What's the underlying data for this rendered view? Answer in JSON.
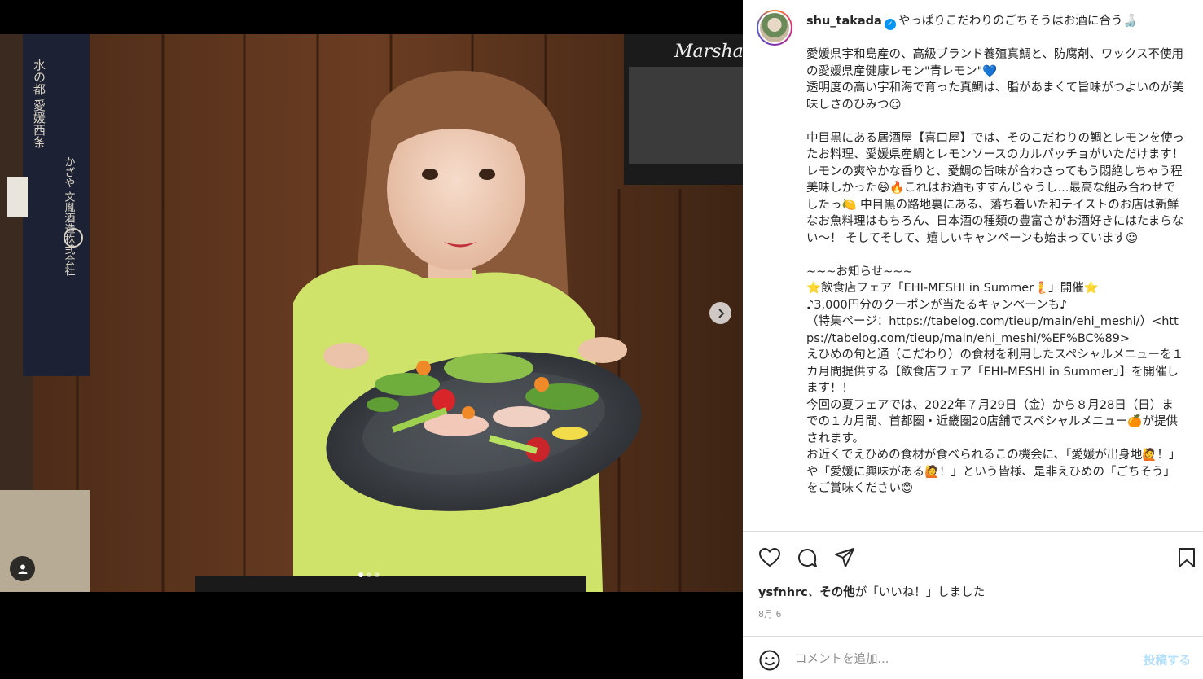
{
  "post": {
    "username": "shu_takada",
    "headline": "やっぱりこだわりのごちそうはお酒に合う🍶",
    "caption": "愛媛県宇和島産の、高級ブランド養殖真鯛と、防腐剤、ワックス不使用の愛媛県産健康レモン\"青レモン\"💙\n透明度の高い宇和海で育った真鯛は、脂があまくて旨味がつよいのが美味しさのひみつ☺\n\n中目黒にある居酒屋【喜口屋】では、そのこだわりの鯛とレモンを使ったお料理、愛媛県産鯛とレモンソースのカルパッチョがいただけます！\nレモンの爽やかな香りと、愛鯛の旨味が合わさってもう悶絶しちゃう程美味しかった😆🔥これはお酒もすすんじゃうし...最高な組み合わせでしたっ🍋 中目黒の路地裏にある、落ち着いた和テイストのお店は新鮮なお魚料理はもちろん、日本酒の種類の豊富さがお酒好きにはたまらない〜！ そしてそして、嬉しいキャンペーンも始まっています☺\n\n~~~お知らせ~~~\n⭐飲食店フェア「EHI-MESHI in Summer🧜」開催⭐\n♪3,000円分のクーポンが当たるキャンペーンも♪\n（特集ページ：https://tabelog.com/tieup/main/ehi_meshi/）<https://tabelog.com/tieup/main/ehi_meshi/%EF%BC%89>\nえひめの旬と通（こだわり）の食材を利用したスペシャルメニューを１カ月間提供する【飲食店フェア「EHI-MESHI in Summer」】を開催します！！\n今回の夏フェアでは、2022年７月29日（金）から８月28日（日）までの１カ月間、首都圏・近畿圏20店舗でスペシャルメニュー🍊が提供されます。\nお近くでえひめの食材が食べられるこの機会に、「愛媛が出身地🙋！」や「愛媛に興味がある🙋！」という皆様、是非えひめの「ごちそう」をご賞味ください😊",
    "liked_by_user": "ysfnhrc",
    "liked_by_others": "その他",
    "liked_by_suffix": "が「いいね！」しました",
    "liked_by_separator": "、",
    "date": "8月 6"
  },
  "comment": {
    "placeholder": "コメントを追加...",
    "post_label": "投稿する"
  },
  "carousel": {
    "current_index": 1,
    "total": 3
  },
  "photo_text": {
    "banner_left": "水の都 愛媛西条",
    "banner_right": "かざや 文胤酒造株式会社",
    "amp_logo": "Marshall"
  },
  "colors": {
    "verified": "#0095f6",
    "post_button_disabled": "#b2dffc",
    "link_text": "#00376b"
  },
  "icons": [
    "heart-icon",
    "comment-icon",
    "share-icon",
    "bookmark-icon",
    "emoji-icon",
    "chevron-right-icon",
    "user-tag-icon",
    "verified-icon"
  ]
}
